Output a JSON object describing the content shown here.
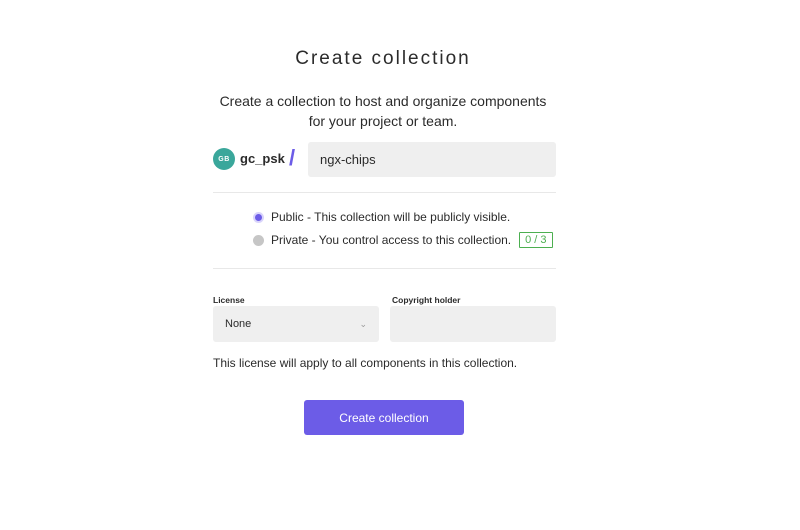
{
  "title": "Create collection",
  "subtitle": "Create a collection to host and organize components for your project or team.",
  "owner": {
    "avatar_initials": "GB",
    "avatar_color": "#3aa79b",
    "name": "gc_psk",
    "separator": "/"
  },
  "collection_name": {
    "value": "ngx-chips"
  },
  "visibility": {
    "public": {
      "label": "Public - This collection will be publicly visible.",
      "selected": true
    },
    "private": {
      "label": "Private - You control access to this collection.",
      "selected": false,
      "count": "0 / 3"
    }
  },
  "license": {
    "label": "License",
    "selected": "None"
  },
  "copyright": {
    "label": "Copyright holder",
    "value": ""
  },
  "license_note": "This license will apply to all components in this collection.",
  "submit_label": "Create collection",
  "colors": {
    "accent": "#6c5ce7",
    "count_badge": "#4caf50",
    "input_bg": "#efefef"
  }
}
